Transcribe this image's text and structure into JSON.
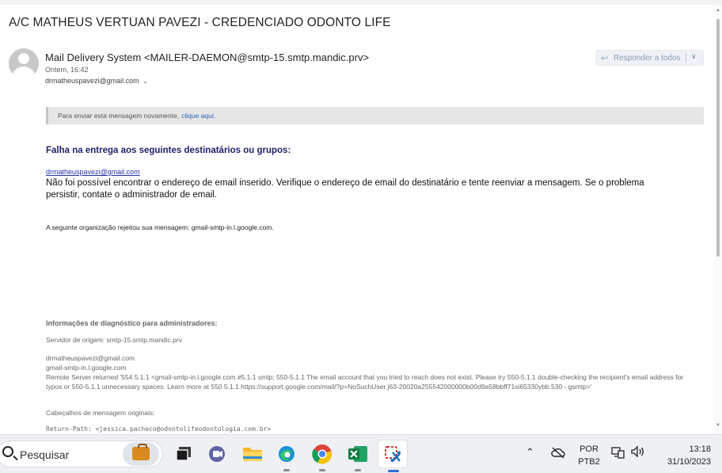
{
  "email": {
    "subject": "A/C MATHEUS VERTUAN PAVEZI - CREDENCIADO ODONTO LIFE",
    "sender": "Mail Delivery System <MAILER-DAEMON@smtp-15.smtp.mandic.prv>",
    "date": "Ontem, 16:42",
    "to": "drmatheuspavezi@gmail.com",
    "reply_all_label": "Responder a todos",
    "resend_text": "Para enviar esta mensagem novamente,",
    "resend_link": "clique aqui.",
    "fail_title": "Falha na entrega aos seguintes destinatários ou grupos:",
    "fail_email": "drmatheuspavezi@gmail.com",
    "fail_message": "Não foi possível encontrar o endereço de email inserido. Verifique o endereço de email do destinatário e tente reenviar a mensagem. Se o problema persistir, contate o administrador de email.",
    "org_rejected": "A seguinte organização rejeitou sua mensagem: gmail-smtp-in.l.google.com.",
    "diag_title": "Informações de diagnóstico para administradores:",
    "diag_server": "Servidor de origem: smtp-15.smtp.mandic.prv",
    "diag_recipient": "drmatheuspavezi@gmail.com",
    "diag_remote": "gmail-smtp-in.l.google.com",
    "diag_error": "Remote Server returned '554 5.1.1 <gmail-smtp-in.l.google.com #5.1.1 smtp; 550-5.1.1 The email account that you tried to reach does not exist. Please try 550-5.1.1 double-checking the recipient's email address for typos or 550-5.1.1 unnecessary spaces. Learn more at 550 5.1.1 https://support.google.com/mail/?p=NoSuchUser j63-20020a255542000000b00d9a58bbff71si65330ybb.530 - gsmtp>'",
    "headers_title": "Cabeçalhos de mensagem originais:",
    "return_path": "Return-Path: <jessica.pacheco@odontolifeodontologia.com.br>"
  },
  "taskbar": {
    "search_placeholder": "Pesquisar",
    "lang_top": "POR",
    "lang_bottom": "PTB2",
    "time": "13:18",
    "date": "31/10/2023"
  },
  "colors": {
    "fail_title": "#1f1f6b",
    "link": "#2a63b8",
    "taskbar_bg": "#eef0f4"
  }
}
